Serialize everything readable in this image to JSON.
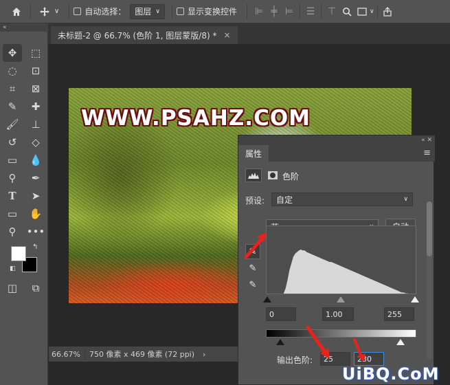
{
  "options_bar": {
    "auto_select_label": "自动选择：",
    "layer_dropdown": "图层",
    "show_transform_label": "显示变换控件"
  },
  "left_panel_header": "«",
  "document": {
    "tab_title": "未标题-2 @ 66.7% (色阶 1, 图层蒙版/8) *",
    "tab_close": "×",
    "artwork_text": "WWW.PSAHZ.COM"
  },
  "status_bar": {
    "zoom": "66.67%",
    "size": "750 像素 x 469 像素 (72 ppi)",
    "arrow": "›"
  },
  "properties_panel": {
    "collapse": "«",
    "tab_label": "属性",
    "title": "色阶",
    "preset_label": "预设:",
    "preset_value": "自定",
    "channel_value": "蓝",
    "auto_button": "自动",
    "input_black": "0",
    "input_gamma": "1.00",
    "input_white": "255",
    "output_label": "输出色阶:",
    "output_black": "25",
    "output_white": "230"
  },
  "histogram": [
    0,
    0,
    0,
    0,
    0,
    0,
    0,
    0,
    0,
    2,
    8,
    18,
    30,
    38,
    46,
    50,
    52,
    54,
    55,
    54,
    54,
    52,
    51,
    50,
    49,
    48,
    47,
    46,
    45,
    44,
    43,
    42,
    41,
    40,
    40,
    39,
    38,
    37,
    36,
    35,
    34,
    33,
    32,
    31,
    30,
    29,
    28,
    27,
    26,
    25,
    24,
    23,
    22,
    21,
    20,
    19,
    18,
    17,
    16,
    15,
    14,
    13,
    12,
    11,
    10,
    9,
    8,
    7,
    6,
    5,
    4,
    3,
    3,
    2,
    2,
    1,
    1,
    1,
    0,
    0
  ],
  "watermark": "UiBQ.CoM",
  "colors": {
    "accent": "#3a8ee6",
    "arrow_red": "#e8231c",
    "panel_bg": "#535353",
    "canvas_bg": "#282828"
  }
}
